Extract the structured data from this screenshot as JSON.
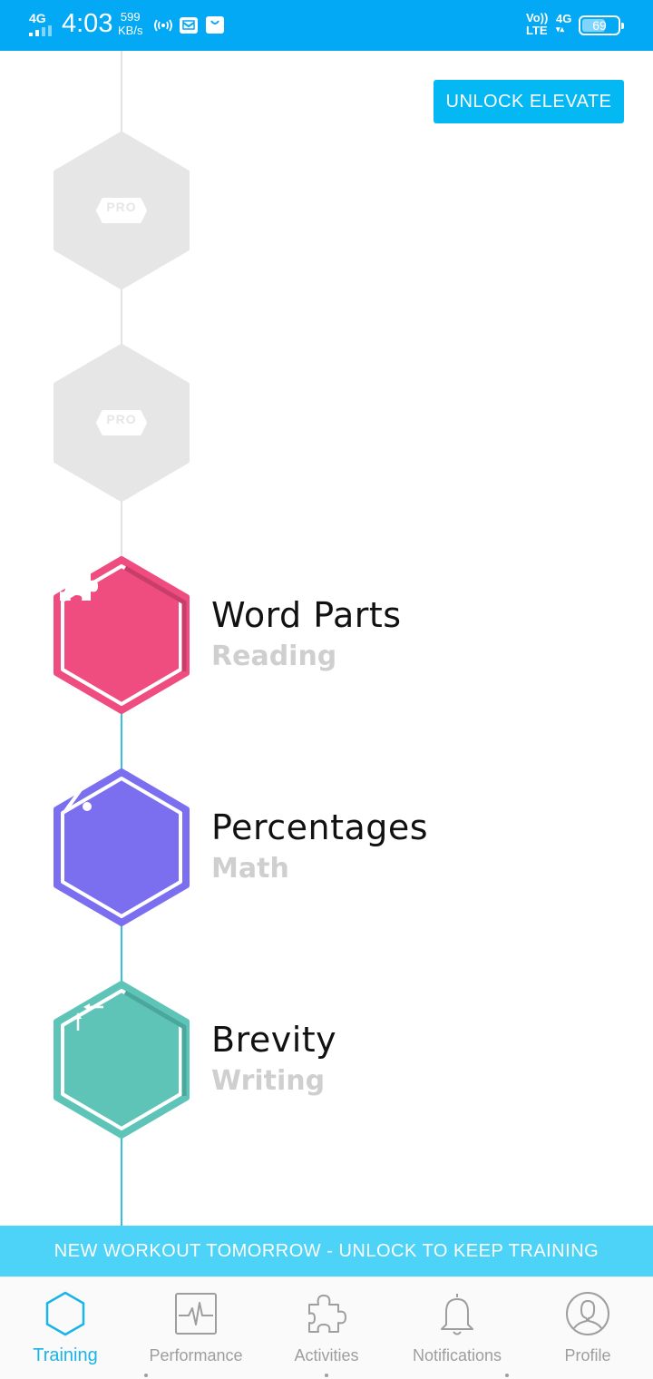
{
  "status_bar": {
    "network": "4G",
    "time": "4:03",
    "speed_value": "599",
    "speed_unit": "KB/s",
    "volte_top": "Vo))",
    "volte_bottom": "LTE",
    "data_type": "4G",
    "battery": "69",
    "battery_level": 0.69
  },
  "unlock_button": {
    "label": "UNLOCK ELEVATE"
  },
  "locked_items": [
    {
      "badge": "PRO"
    },
    {
      "badge": "PRO"
    }
  ],
  "activities": [
    {
      "title": "Word Parts",
      "category": "Reading",
      "color": "#ef4c7f",
      "icon": "puzzle-icon"
    },
    {
      "title": "Percentages",
      "category": "Math",
      "color": "#7b6ff0",
      "icon": "percent-icon"
    },
    {
      "title": "Brevity",
      "category": "Writing",
      "color": "#5ec4b8",
      "icon": "compress-arrows-icon"
    }
  ],
  "banner": {
    "text": "NEW WORKOUT TOMORROW - UNLOCK TO KEEP TRAINING"
  },
  "bottom_nav": {
    "items": [
      {
        "label": "Training",
        "icon": "hexagon-icon",
        "active": true
      },
      {
        "label": "Performance",
        "icon": "pulse-chart-icon",
        "active": false
      },
      {
        "label": "Activities",
        "icon": "puzzle-icon",
        "active": false
      },
      {
        "label": "Notifications",
        "icon": "bell-icon",
        "active": false
      },
      {
        "label": "Profile",
        "icon": "person-icon",
        "active": false
      }
    ]
  },
  "colors": {
    "status_bar": "#03a9f4",
    "accent": "#03b8f3",
    "banner": "#4dd3f8",
    "locked_hex": "#e6e6e6",
    "subtitle": "#cfcfcf"
  }
}
